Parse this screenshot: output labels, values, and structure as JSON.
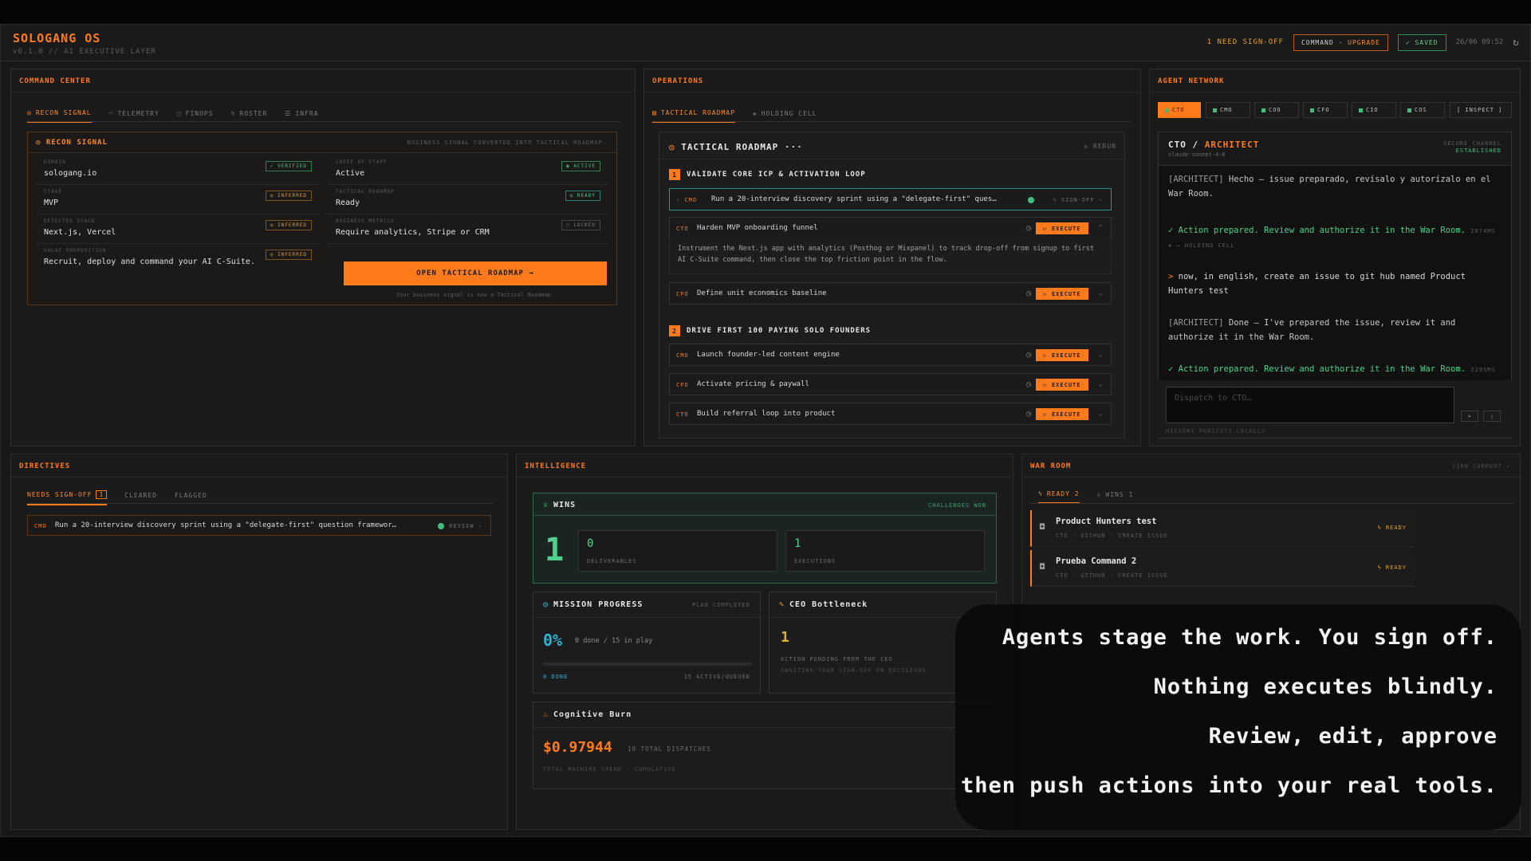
{
  "topbar": {
    "brand": "SOLOGANG OS",
    "version": "v0.1.0 // AI EXECUTIVE LAYER",
    "need_signoff": "1 NEED SIGN-OFF",
    "command_label": "COMMAND",
    "upgrade_label": "UPGRADE",
    "saved_label": "✓ SAVED",
    "datetime": "26/06 09:52",
    "refresh_icon": "refresh-icon"
  },
  "command_center": {
    "title": "COMMAND CENTER",
    "tabs": [
      {
        "label": "RECON SIGNAL",
        "icon": "◎"
      },
      {
        "label": "TELEMETRY",
        "icon": "◠"
      },
      {
        "label": "FINOPS",
        "icon": "▢"
      },
      {
        "label": "ROSTER",
        "icon": "ϟ"
      },
      {
        "label": "INFRA",
        "icon": "☰"
      }
    ],
    "recon": {
      "title": "RECON SIGNAL",
      "subtitle": "BUSINESS SIGNAL CONVERTED INTO TACTICAL ROADMAP.",
      "left_fields": [
        {
          "label": "DOMAIN",
          "value": "sologang.io",
          "badge": "✓ VERIFIED",
          "badge_type": "green"
        },
        {
          "label": "STAGE",
          "value": "MVP",
          "badge": "◎ INFERRED",
          "badge_type": "orange"
        },
        {
          "label": "DETECTED STACK",
          "value": "Next.js, Vercel",
          "badge": "◎ INFERRED",
          "badge_type": "orange"
        },
        {
          "label": "VALUE PROPOSITION",
          "value": "Recruit, deploy and command your AI C-Suite.",
          "badge": "◎ INFERRED",
          "badge_type": "orange"
        }
      ],
      "right_fields": [
        {
          "label": "CHIEF OF STAFF",
          "value": "Active",
          "badge": "◉ ACTIVE",
          "badge_type": "green"
        },
        {
          "label": "TACTICAL ROADMAP",
          "value": "Ready",
          "badge": "◎ READY",
          "badge_type": "teal"
        },
        {
          "label": "BUSINESS METRICS",
          "value": "Require analytics, Stripe or CRM",
          "badge": "▢ LOCKED",
          "badge_type": "grey"
        }
      ],
      "open_button": "OPEN TACTICAL ROADMAP →",
      "open_note": "Your business signal is now a Tactical Roadmap."
    }
  },
  "operations": {
    "title": "OPERATIONS",
    "tabs": [
      {
        "label": "TACTICAL ROADMAP",
        "icon": "▤"
      },
      {
        "label": "HOLDING CELL",
        "icon": "✚"
      }
    ],
    "roadmap": {
      "title": "TACTICAL ROADMAP ···",
      "rerun": "↻ RERUN",
      "sections": [
        {
          "num": "1",
          "title": "VALIDATE CORE ICP & ACTIVATION LOOP"
        },
        {
          "num": "2",
          "title": "DRIVE FIRST 100 PAYING SOLO FOUNDERS"
        }
      ],
      "tasks": [
        {
          "who": "CMO",
          "text": "Run a 20-interview discovery sprint using a \"delegate-first\" ques…",
          "action": "✎ SIGN-OFF ›"
        },
        {
          "who": "CTO",
          "text": "Harden MVP onboarding funnel",
          "action": "▷ EXECUTE"
        },
        {
          "who": "CFO",
          "text": "Define unit economics baseline",
          "action": "▷ EXECUTE"
        },
        {
          "who": "CMO",
          "text": "Launch founder-led content engine",
          "action": "▷ EXECUTE"
        },
        {
          "who": "CFO",
          "text": "Activate pricing & paywall",
          "action": "▷ EXECUTE"
        },
        {
          "who": "CTO",
          "text": "Build referral loop into product",
          "action": "▷ EXECUTE"
        }
      ],
      "expanded_text": "Instrument the Next.js app with analytics (Posthog or Mixpanel) to track drop-off from signup to first AI C-Suite command, then close the top friction point in the flow."
    }
  },
  "agent_network": {
    "title": "AGENT NETWORK",
    "tabs": [
      "CTO",
      "CMO",
      "COO",
      "CFO",
      "CIO",
      "COS",
      "[ INSPECT ]"
    ],
    "chat": {
      "agent": "CTO",
      "role": "ARCHITECT",
      "model": "claude-sonnet-4-6",
      "secure": "SECURE_CHANNEL",
      "established": "ESTABLISHED",
      "messages": [
        {
          "tag": "[ARCHITECT]",
          "text": "Hecho — issue preparado, revísalo y autorízalo en el War Room."
        },
        {
          "ok": "✓ Action prepared. Review and authorize it in the War Room.",
          "meta": "2874MS ✚ → HOLDING CELL"
        },
        {
          "user": "now, in english, create an issue to git hub named Product Hunters test"
        },
        {
          "tag": "[ARCHITECT]",
          "text": "Done — I've prepared the issue, review it and authorize it in the War Room."
        },
        {
          "ok": "✓ Action prepared. Review and authorize it in the War Room.",
          "meta": "2295MS ✚ → HOLDING CELL"
        }
      ],
      "placeholder": "Dispatch to CTO…",
      "history_note": "HISTORY PERSISTS LOCALLY"
    }
  },
  "directives": {
    "title": "DIRECTIVES",
    "tabs": [
      {
        "label": "NEEDS SIGN-OFF",
        "count": "1"
      },
      {
        "label": "CLEARED"
      },
      {
        "label": "FLAGGED"
      }
    ],
    "item": {
      "who": "CMO",
      "text": "Run a 20-interview discovery sprint using a \"delegate-first\" question framewor…",
      "action": "REVIEW ›"
    }
  },
  "intelligence": {
    "title": "INTELLIGENCE",
    "wins": {
      "title": "WINS",
      "subtitle": "CHALLENGES WON",
      "count": "1",
      "boxes": [
        {
          "value": "0",
          "label": "DELIVERABLES"
        },
        {
          "value": "1",
          "label": "EXECUTIONS"
        }
      ]
    },
    "mission": {
      "title": "MISSION PROGRESS",
      "subtitle": "PLAN COMPLETED",
      "percent": "0%",
      "note": "0 done / 15 in play",
      "progress": 0,
      "done_label": "0 DONE",
      "queued_label": "15 ACTIVE/QUEUED"
    },
    "bottleneck": {
      "title": "CEO Bottleneck",
      "value": "1",
      "line1": "ACTION PENDING FROM THE CEO",
      "line2": "AWAITING YOUR SIGN-OFF ON DECISIONS"
    },
    "burn": {
      "title": "Cognitive Burn",
      "value": "$0.97944",
      "dispatches": "10 TOTAL DISPATCHES",
      "label": "TOTAL MACHINE SPEND · CUMULATIVE"
    }
  },
  "war_room": {
    "title": "WAR ROOM",
    "view_current": "VIEW CURRENT ↗",
    "tabs": [
      {
        "label": "READY 2",
        "icon": "ϟ"
      },
      {
        "label": "WINS 1",
        "icon": "♕"
      }
    ],
    "items": [
      {
        "title": "Product Hunters test",
        "sub": "CTO · GITHUB · CREATE ISSUE",
        "status": "ϟ READY"
      },
      {
        "title": "Prueba Command 2",
        "sub": "CTO · GITHUB · CREATE ISSUE",
        "status": "ϟ READY"
      }
    ]
  },
  "overlay": {
    "lines": [
      "Agents stage the work. You sign off.",
      "Nothing executes blindly.",
      "Review, edit, approve",
      "then push actions into your real tools."
    ]
  },
  "colors": {
    "accent": "#ff7a1a",
    "success": "#4fd08f",
    "info": "#2fb0d0",
    "background": "#181818"
  }
}
